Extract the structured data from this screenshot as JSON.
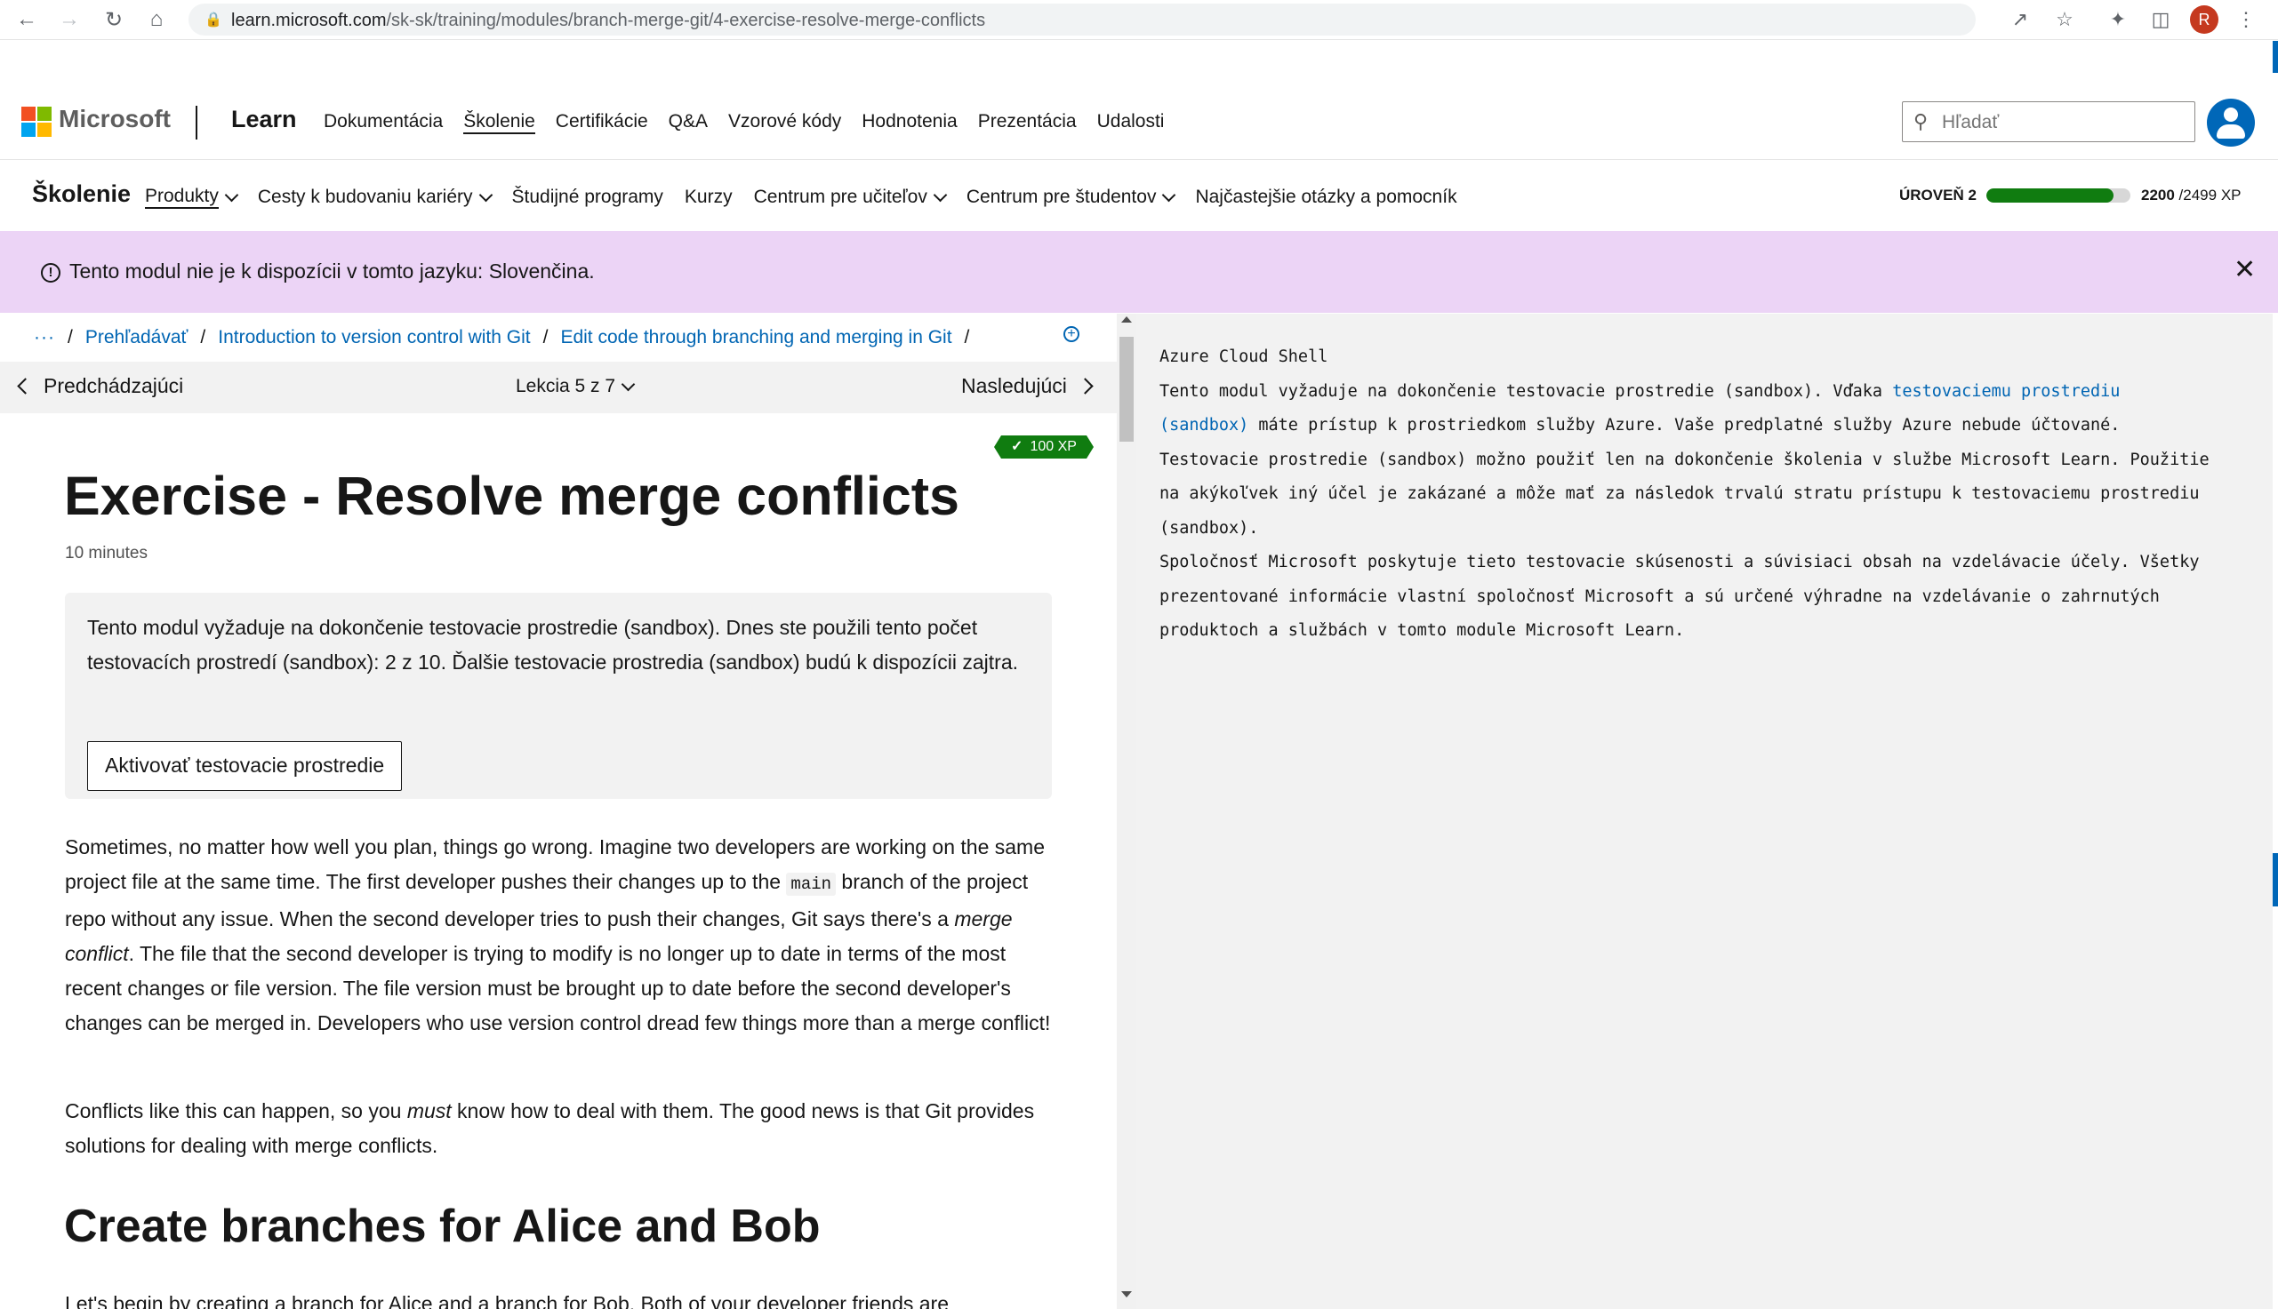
{
  "browser": {
    "url_host": "learn.microsoft.com",
    "url_path": "/sk-sk/training/modules/branch-merge-git/4-exercise-resolve-merge-conflicts",
    "profile_initial": "R",
    "icons": [
      "back-icon",
      "forward-icon",
      "reload-icon",
      "home-icon",
      "lock-icon",
      "share-icon",
      "star-icon",
      "extensions-icon",
      "sidepanel-icon",
      "menu-icon"
    ]
  },
  "header": {
    "brand": "Microsoft",
    "product": "Learn",
    "nav": [
      "Dokumentácia",
      "Školenie",
      "Certifikácie",
      "Q&A",
      "Vzorové kódy",
      "Hodnotenia",
      "Prezentácia",
      "Udalosti"
    ],
    "search_placeholder": "Hľadať"
  },
  "training_nav": {
    "title": "Školenie",
    "items": [
      "Produkty",
      "Cesty k budovaniu kariéry",
      "Študijné programy",
      "Kurzy",
      "Centrum pre učiteľov",
      "Centrum pre študentov",
      "Najčastejšie otázky a pomocník"
    ],
    "level_label": "ÚROVEŇ 2",
    "xp_current": "2200",
    "xp_total": " /2499 XP",
    "xp_progress": 0.88
  },
  "banner": {
    "text": "Tento modul nie je k dispozícii v tomto jazyku: Slovenčina."
  },
  "breadcrumb": {
    "ellipsis": "···",
    "items": [
      "Prehľadávať",
      "Introduction to version control with Git",
      "Edit code through branching and merging in Git"
    ]
  },
  "lesson_nav": {
    "prev": "Predchádzajúci",
    "position": "Lekcia 5 z 7",
    "next": "Nasledujúci"
  },
  "article": {
    "xp_badge": "100 XP",
    "title": "Exercise - Resolve merge conflicts",
    "duration": "10 minutes",
    "sandbox_text": "Tento modul vyžaduje na dokončenie testovacie prostredie (sandbox). Dnes ste použili tento počet testovacích prostredí (sandbox): 2 z 10. Ďalšie testovacie prostredia (sandbox) budú k dispozícii zajtra.",
    "sandbox_button": "Aktivovať testovacie prostredie",
    "p1_a": "Sometimes, no matter how well you plan, things go wrong. Imagine two developers are working on the same project file at the same time. The first developer pushes their changes up to the ",
    "p1_code": "main",
    "p1_b": " branch of the project repo without any issue. When the second developer tries to push their changes, Git says there's a ",
    "p1_em": "merge conflict",
    "p1_c": ". The file that the second developer is trying to modify is no longer up to date in terms of the most recent changes or file version. The file version must be brought up to date before the second developer's changes can be merged in. Developers who use version control dread few things more than a merge conflict!",
    "p2_a": "Conflicts like this can happen, so you ",
    "p2_em": "must",
    "p2_b": " know how to deal with them. The good news is that Git provides solutions for dealing with merge conflicts.",
    "h2": "Create branches for Alice and Bob",
    "p3": "Let's begin by creating a branch for Alice and a branch for Bob. Both of your developer friends are"
  },
  "cloud_shell": {
    "title": "Azure Cloud Shell",
    "l1_a": "Tento modul vyžaduje na dokončenie testovacie prostredie (sandbox). Vďaka ",
    "l1_link_a": "testovaciemu prostrediu",
    "l1_link_b": "(sandbox)",
    "l1_b": " máte prístup k prostriedkom služby Azure. Vaše predplatné služby Azure nebude účtované.",
    "l2_a": "Testovacie prostredie (sandbox) možno použiť len na dokončenie školenia v službe Microsoft Learn. Použitie",
    "l2_b": "na akýkoľvek iný účel je zakázané a môže mať za následok trvalú stratu prístupu k testovaciemu prostrediu",
    "l2_c": "(sandbox).",
    "l3_a": "Spoločnosť Microsoft poskytuje tieto testovacie skúsenosti a súvisiaci obsah na vzdelávacie účely. Všetky",
    "l3_b": "prezentované informácie vlastní spoločnosť Microsoft a sú určené výhradne na vzdelávanie o zahrnutých",
    "l3_c": "produktoch a službách v tomto module Microsoft Learn."
  },
  "colors": {
    "accent": "#0065b3",
    "banner": "#ecd4f6",
    "xp_green": "#107c10",
    "logo": [
      "#f25022",
      "#7fba00",
      "#00a4ef",
      "#ffb900"
    ]
  }
}
